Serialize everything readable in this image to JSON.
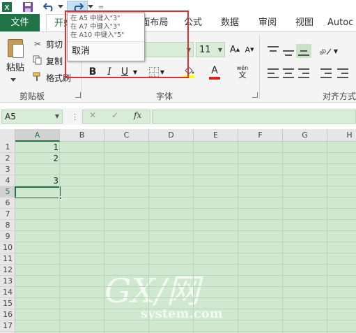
{
  "quick_access": {
    "excel_icon": "excel-logo-icon",
    "save_icon": "save-icon",
    "undo_icon": "undo-icon",
    "redo_icon": "redo-icon",
    "customize_glyph": "="
  },
  "tabs": {
    "file": "文件",
    "home": "开始",
    "page_layout": "布局",
    "page_layout_prefix": "面",
    "formulas": "公式",
    "data": "数据",
    "review": "审阅",
    "view": "视图",
    "autocad": "Autoc"
  },
  "redo_dropdown": {
    "items": [
      "在 A5 中键入\"3\"",
      "在 A7 中键入\"3\"",
      "在 A10 中键入\"5\""
    ],
    "cancel": "取消"
  },
  "ribbon": {
    "clipboard": {
      "paste": "粘贴",
      "cut": "剪切",
      "copy": "复制",
      "format_painter": "格式刷",
      "group_label": "剪贴板"
    },
    "font": {
      "size": "11",
      "grow": "A",
      "shrink": "A",
      "bold": "B",
      "italic": "I",
      "underline": "U",
      "font_color_glyph": "A",
      "phonetic": "wén",
      "phonetic_sub": "文",
      "group_label": "字体"
    },
    "alignment": {
      "group_label": "对齐方式"
    }
  },
  "formula_bar": {
    "name_box": "A5",
    "sep": "⋮",
    "cancel": "✕",
    "enter": "✓",
    "fx": "fx",
    "value": ""
  },
  "grid": {
    "columns": [
      "A",
      "B",
      "C",
      "D",
      "E",
      "F",
      "G",
      "H"
    ],
    "rows": [
      "1",
      "2",
      "3",
      "4",
      "5",
      "6",
      "7",
      "8",
      "9",
      "10",
      "11",
      "12",
      "13",
      "14",
      "15",
      "16",
      "17"
    ],
    "selected_column": "A",
    "selected_row": "5",
    "cells": {
      "A1": "1",
      "A2": "2",
      "A4": "3"
    }
  },
  "colors": {
    "accent": "#217346",
    "sheet_bg": "#cfe8cf",
    "highlight_red": "#d93030"
  },
  "watermark": {
    "logo_text": "GX/网",
    "domain_text": "system.com"
  }
}
